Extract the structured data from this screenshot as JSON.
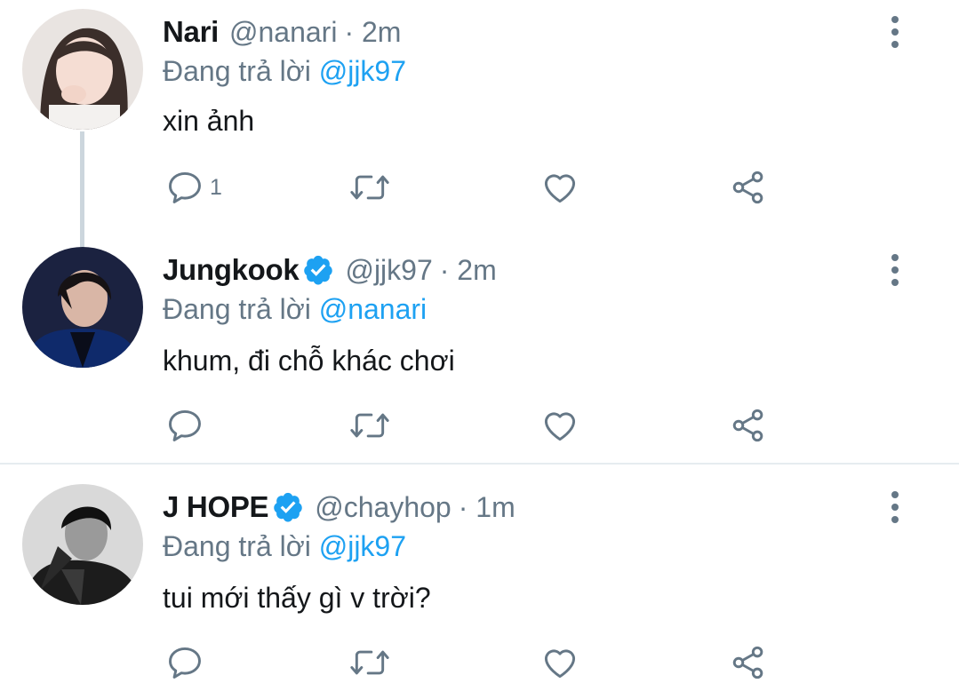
{
  "colors": {
    "link": "#1da1f2",
    "secondary_text": "#657786",
    "primary_text": "#14171a",
    "verified_badge": "#1da1f2",
    "divider": "#e6ecf0"
  },
  "tweets": [
    {
      "name": "Nari",
      "handle": "@nanari",
      "time": "· 2m",
      "verified": false,
      "replying_prefix": "Đang trả lời",
      "replying_to": "@jjk97",
      "text": "xin ảnh",
      "reply_count": "1",
      "avatar_icon": "user-avatar-photo"
    },
    {
      "name": "Jungkook",
      "handle": "@jjk97",
      "time": "· 2m",
      "verified": true,
      "replying_prefix": "Đang trả lời",
      "replying_to": "@nanari",
      "text": "khum, đi chỗ khác chơi",
      "reply_count": "",
      "avatar_icon": "user-avatar-photo"
    },
    {
      "name": "J HOPE",
      "handle": "@chayhop",
      "time": "· 1m",
      "verified": true,
      "replying_prefix": "Đang trả lời",
      "replying_to": "@jjk97",
      "text": "tui mới thấy gì v trời?",
      "reply_count": "",
      "avatar_icon": "user-avatar-photo"
    }
  ],
  "action_icons": [
    "reply-icon",
    "retweet-icon",
    "like-icon",
    "share-icon"
  ]
}
